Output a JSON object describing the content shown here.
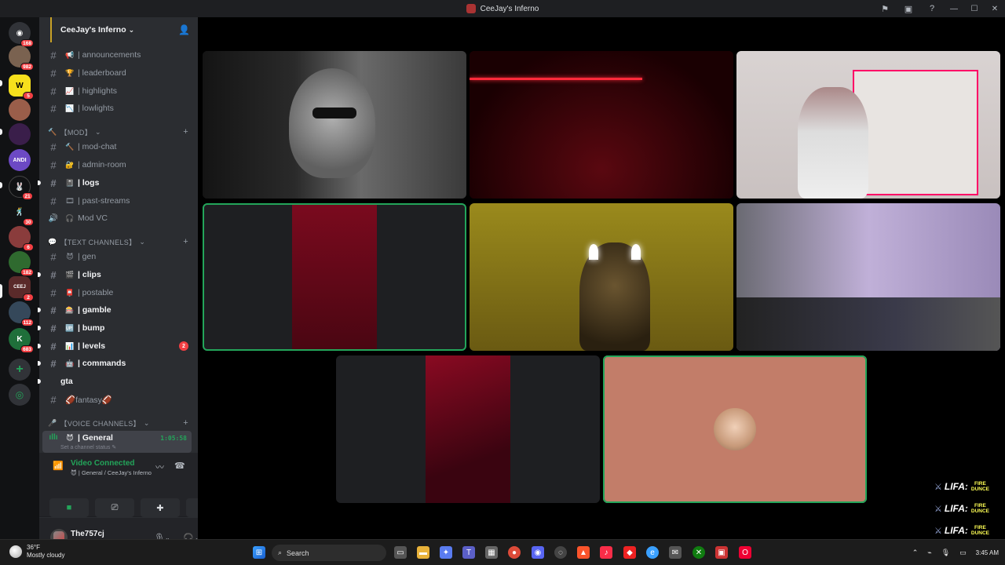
{
  "window": {
    "title": "CeeJay's Inferno"
  },
  "server_rail": {
    "badges": [
      "168",
      "982",
      "5",
      "21",
      "30",
      "6",
      "182",
      "2",
      "112",
      "683"
    ]
  },
  "server": {
    "name": "CeeJay's Inferno"
  },
  "channels_top": [
    {
      "name": "| announcements",
      "emoji": "📢"
    },
    {
      "name": "| leaderboard",
      "emoji": "🏆"
    },
    {
      "name": "| highlights",
      "emoji": "📈"
    },
    {
      "name": "| lowlights",
      "emoji": "📉"
    }
  ],
  "category_mod": "【MOD】",
  "channels_mod": [
    {
      "name": "| mod-chat",
      "emoji": "🔨"
    },
    {
      "name": "| admin-room",
      "emoji": "🔐"
    },
    {
      "name": "| logs",
      "emoji": "📓"
    },
    {
      "name": "| past-streams",
      "emoji": "🎞"
    },
    {
      "name": "Mod VC",
      "emoji": ""
    }
  ],
  "category_text": "【TEXT CHANNELS】",
  "channels_text": [
    {
      "name": "| gen",
      "emoji": "😈"
    },
    {
      "name": "| clips",
      "emoji": "🎬"
    },
    {
      "name": "| postable",
      "emoji": "📮"
    },
    {
      "name": "| gamble",
      "emoji": "🎰"
    },
    {
      "name": "| bump",
      "emoji": "🆙"
    },
    {
      "name": "| levels",
      "emoji": "📊",
      "mentions": "2"
    },
    {
      "name": "| commands",
      "emoji": "🤖"
    },
    {
      "name": "gta",
      "emoji": ""
    },
    {
      "name": "🏈fantasy🏈",
      "emoji": ""
    }
  ],
  "category_voice": "【VOICE CHANNELS】",
  "voice_channel": {
    "name": "| General",
    "emoji": "😈",
    "timer": "1:05:58",
    "status_placeholder": "Set a channel status"
  },
  "voice_panel": {
    "title": "Video Connected",
    "subtitle": "| General / CeeJay's Inferno"
  },
  "user": {
    "display_name": "The757cj",
    "username": "the757cj"
  },
  "overlay": {
    "label": "LIFA:",
    "flag_lines": [
      "FIRE",
      "DUNCE"
    ]
  },
  "taskbar": {
    "temperature": "36°F",
    "condition": "Mostly cloudy",
    "search_label": "Search",
    "time": "3:45 AM"
  },
  "colors": {
    "accent_green": "#23a55a",
    "mention_red": "#f23f43",
    "sidebar_bg": "#2b2d31",
    "panel_bg": "#232428"
  }
}
